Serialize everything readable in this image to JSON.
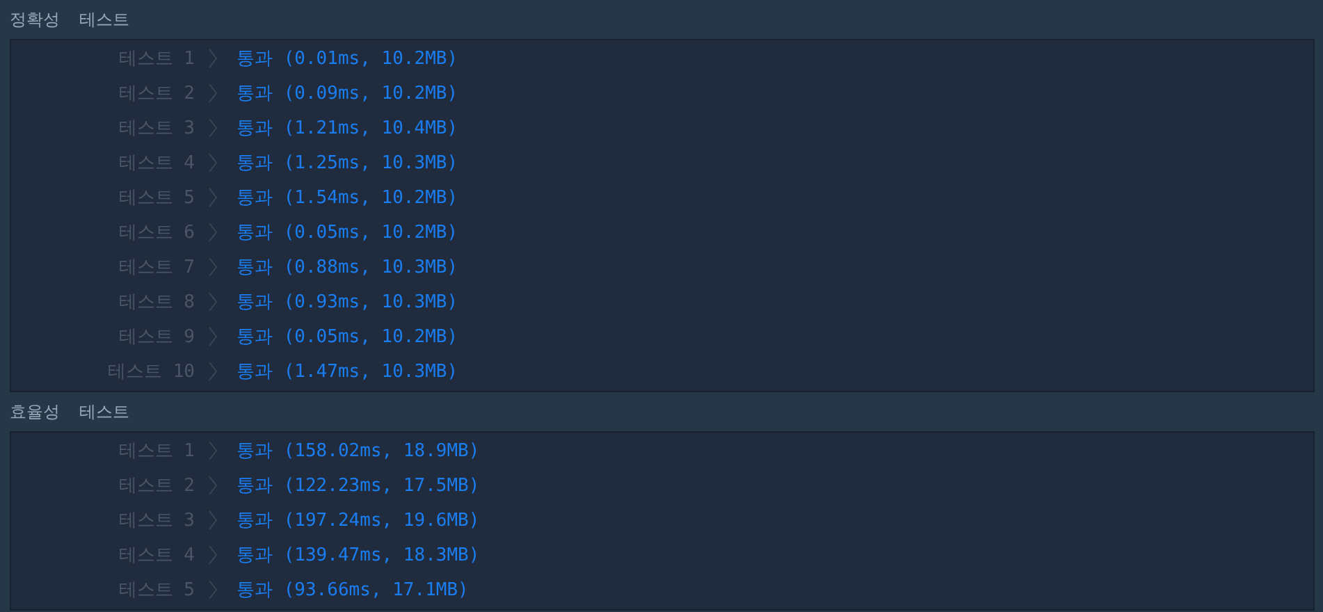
{
  "sections": [
    {
      "title": "정확성",
      "subtitle": "테스트",
      "results": [
        {
          "label": "테스트 1",
          "result": "통과 (0.01ms, 10.2MB)"
        },
        {
          "label": "테스트 2",
          "result": "통과 (0.09ms, 10.2MB)"
        },
        {
          "label": "테스트 3",
          "result": "통과 (1.21ms, 10.4MB)"
        },
        {
          "label": "테스트 4",
          "result": "통과 (1.25ms, 10.3MB)"
        },
        {
          "label": "테스트 5",
          "result": "통과 (1.54ms, 10.2MB)"
        },
        {
          "label": "테스트 6",
          "result": "통과 (0.05ms, 10.2MB)"
        },
        {
          "label": "테스트 7",
          "result": "통과 (0.88ms, 10.3MB)"
        },
        {
          "label": "테스트 8",
          "result": "통과 (0.93ms, 10.3MB)"
        },
        {
          "label": "테스트 9",
          "result": "통과 (0.05ms, 10.2MB)"
        },
        {
          "label": "테스트 10",
          "result": "통과 (1.47ms, 10.3MB)"
        }
      ]
    },
    {
      "title": "효율성",
      "subtitle": "테스트",
      "results": [
        {
          "label": "테스트 1",
          "result": "통과 (158.02ms, 18.9MB)"
        },
        {
          "label": "테스트 2",
          "result": "통과 (122.23ms, 17.5MB)"
        },
        {
          "label": "테스트 3",
          "result": "통과 (197.24ms, 19.6MB)"
        },
        {
          "label": "테스트 4",
          "result": "통과 (139.47ms, 18.3MB)"
        },
        {
          "label": "테스트 5",
          "result": "통과 (93.66ms, 17.1MB)"
        }
      ]
    }
  ]
}
